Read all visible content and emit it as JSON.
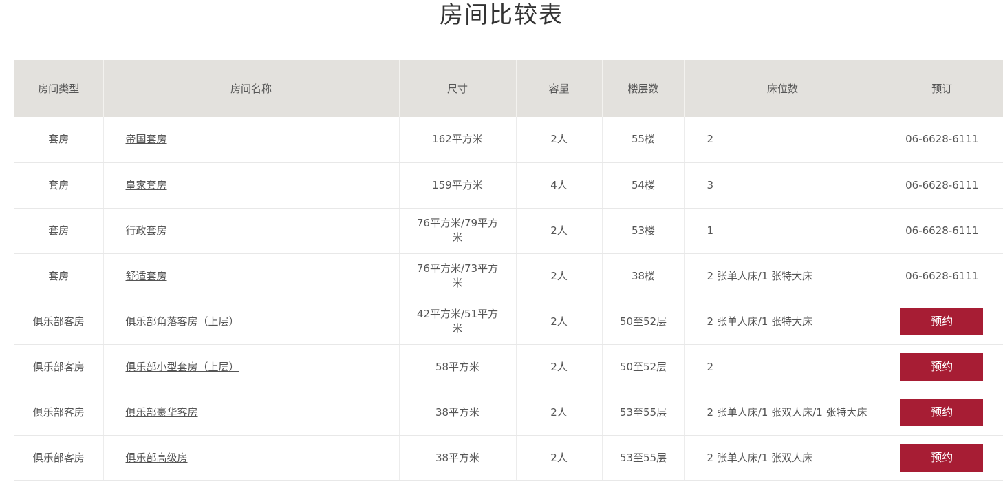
{
  "page": {
    "title": "房间比较表"
  },
  "table": {
    "headers": [
      "房间类型",
      "房间名称",
      "尺寸",
      "容量",
      "楼层数",
      "床位数",
      "预订"
    ],
    "rows": [
      {
        "type": "套房",
        "name": "帝国套房",
        "size": "162平方米",
        "capacity": "2人",
        "floors": "55楼",
        "beds": "2",
        "phone": "06-6628-6111",
        "book": ""
      },
      {
        "type": "套房",
        "name": "皇家套房",
        "size": "159平方米",
        "capacity": "4人",
        "floors": "54楼",
        "beds": "3",
        "phone": "06-6628-6111",
        "book": ""
      },
      {
        "type": "套房",
        "name": "行政套房",
        "size": "76平方米/79平方米",
        "capacity": "2人",
        "floors": "53楼",
        "beds": "1",
        "phone": "06-6628-6111",
        "book": ""
      },
      {
        "type": "套房",
        "name": "舒适套房",
        "size": "76平方米/73平方米",
        "capacity": "2人",
        "floors": "38楼",
        "beds": "2 张单人床/1 张特大床",
        "phone": "06-6628-6111",
        "book": ""
      },
      {
        "type": "俱乐部客房",
        "name": "俱乐部角落客房（上层）",
        "size": "42平方米/51平方米",
        "capacity": "2人",
        "floors": "50至52层",
        "beds": "2 张单人床/1 张特大床",
        "phone": "",
        "book": "预约"
      },
      {
        "type": "俱乐部客房",
        "name": "俱乐部小型套房（上层）",
        "size": "58平方米",
        "capacity": "2人",
        "floors": "50至52层",
        "beds": "2",
        "phone": "",
        "book": "预约"
      },
      {
        "type": "俱乐部客房",
        "name": "俱乐部豪华客房",
        "size": "38平方米",
        "capacity": "2人",
        "floors": "53至55层",
        "beds": "2 张单人床/1 张双人床/1 张特大床",
        "phone": "",
        "book": "预约"
      },
      {
        "type": "俱乐部客房",
        "name": "俱乐部高级房",
        "size": "38平方米",
        "capacity": "2人",
        "floors": "53至55层",
        "beds": "2 张单人床/1 张双人床",
        "phone": "",
        "book": "预约"
      }
    ]
  },
  "colors": {
    "header_bg": "#e3e1dd",
    "book_button": "#a71d34"
  }
}
